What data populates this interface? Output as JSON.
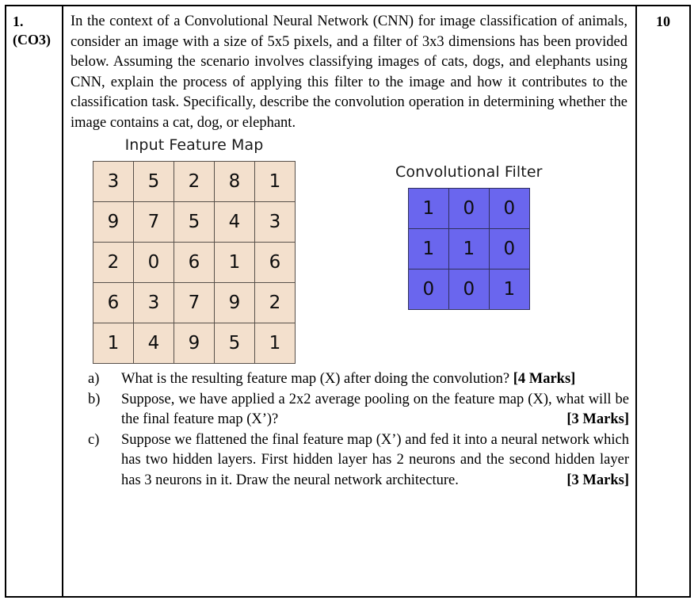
{
  "question": {
    "number": "1.",
    "course_outcome": "(CO3)",
    "marks": "10",
    "body": "In the context of a Convolutional Neural Network (CNN) for image classification of animals, consider an image with a size of 5x5 pixels, and a filter of 3x3 dimensions has been provided below. Assuming the scenario involves classifying images of cats, dogs, and elephants using CNN, explain the process of applying this filter to the image and how it contributes to the classification task. Specifically, describe the convolution operation in determining whether the image contains a cat, dog, or elephant."
  },
  "figures": {
    "input_feature_map": {
      "title": "Input Feature Map",
      "rows": [
        [
          3,
          5,
          2,
          8,
          1
        ],
        [
          9,
          7,
          5,
          4,
          3
        ],
        [
          2,
          0,
          6,
          1,
          6
        ],
        [
          6,
          3,
          7,
          9,
          2
        ],
        [
          1,
          4,
          9,
          5,
          1
        ]
      ],
      "cell_color": "#f3e0cd",
      "border_color": "#57504a"
    },
    "convolutional_filter": {
      "title": "Convolutional Filter",
      "rows": [
        [
          1,
          0,
          0
        ],
        [
          1,
          1,
          0
        ],
        [
          0,
          0,
          1
        ]
      ],
      "cell_color": "#6a66ee",
      "border_color": "#30305a"
    }
  },
  "subquestions": [
    {
      "marker": "a)",
      "text": "What is the resulting feature map (X) after doing the convolution?",
      "marks": "[4 Marks]"
    },
    {
      "marker": "b)",
      "text": "Suppose, we have applied a 2x2 average pooling on the feature map (X), what will be the final feature map (X’)?",
      "marks": "[3 Marks]"
    },
    {
      "marker": "c)",
      "text": "Suppose we flattened the final feature map (X’) and fed it into a neural network which has two hidden layers. First hidden layer has 2 neurons and the second hidden layer has 3 neurons in it. Draw the neural network architecture.",
      "marks": "[3 Marks]"
    }
  ]
}
